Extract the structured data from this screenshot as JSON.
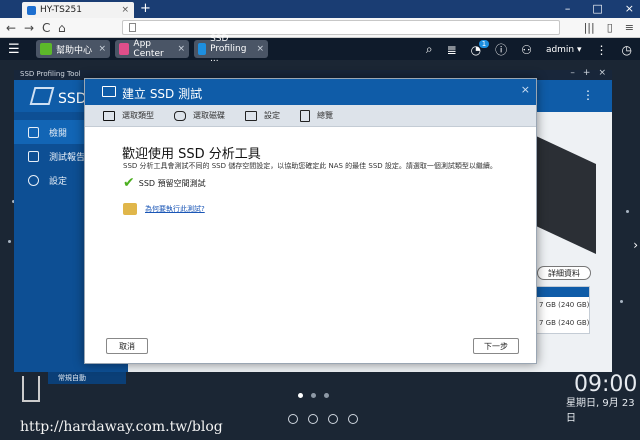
{
  "browser": {
    "tab_title": "HY-TS251",
    "tab_close": "×",
    "new_tab": "+",
    "window_controls": [
      "–",
      "□",
      "×"
    ],
    "nav": [
      "←",
      "→",
      "C",
      "⌂"
    ]
  },
  "qts": {
    "tabs": [
      {
        "label": "幫助中心",
        "icon_color": "#5cb82a"
      },
      {
        "label": "App Center",
        "icon_color": "#e04e8a"
      },
      {
        "label": "SSD Profiling ...",
        "icon_color": "#1d8fe0"
      }
    ],
    "notification_count": "1",
    "user": "admin ▾"
  },
  "app": {
    "window_title": "SSD Profiling Tool",
    "name": "SSD 分",
    "sidebar": [
      "檢閱",
      "測試報告",
      "設定"
    ],
    "sidebar_bottom": "常規自動",
    "details_button": "詳細資料",
    "disks": [
      "7 GB (240 GB)",
      "7 GB (240 GB)"
    ]
  },
  "modal": {
    "title": "建立 SSD 測試",
    "steps": [
      "選取類型",
      "選取磁碟",
      "設定",
      "總覽"
    ],
    "heading": "歡迎使用 SSD 分析工具",
    "description": "SSD 分析工具會測試不同的 SSD 儲存空間設定，以協助您確定此 NAS 的最佳 SSD 設定。請選取一個測試類型以繼續。",
    "check_label": "SSD 預留空間測試",
    "help_link": "為何要執行此測試?",
    "cancel": "取消",
    "next": "下一步"
  },
  "desktop": {
    "time": "09:00",
    "date": "星期日, 9月 23 日",
    "watermark": "http://hardaway.com.tw/blog"
  },
  "colors": {
    "accent": "#0f5ca8",
    "chrome": "#1a3d73",
    "check": "#4caf20"
  }
}
